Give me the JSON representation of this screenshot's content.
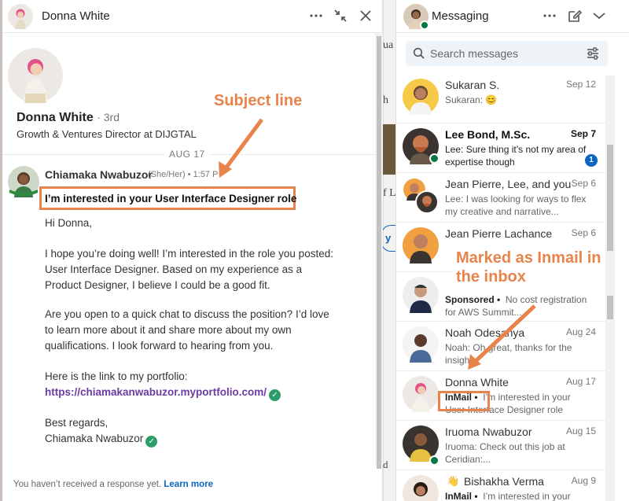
{
  "conversation": {
    "header_name": "Donna White",
    "profile": {
      "name": "Donna White",
      "degree": "· 3rd",
      "title": "Growth & Ventures Director at DIJGTAL"
    },
    "date_divider": "AUG 17",
    "message": {
      "sender": "Chiamaka Nwabuzor",
      "pronouns": "(She/Her) • 1:57 P",
      "subject": "I’m interested in your User Interface Designer role",
      "greeting": "Hi Donna,",
      "para1": "I hope you’re doing well! I’m interested in the role you posted: User Interface Designer. Based on my experience as a Product Designer, I believe I could be a good fit.",
      "para2": "Are you open to a quick chat to discuss the position? I’d love to learn more about it and share more about my own qualifications. I look forward to hearing from you.",
      "para3": "Here is the link to my portfolio:",
      "link": "https://chiamakanwabuzor.myportfolio.com/",
      "closing": "Best regards,",
      "signature": "Chiamaka Nwabuzor"
    },
    "footer": {
      "text": "You haven’t received a response yet.",
      "link": "Learn more"
    }
  },
  "messaging": {
    "title": "Messaging",
    "search_placeholder": "Search messages",
    "items": [
      {
        "name": "Sukaran S.",
        "date": "Sep 12",
        "snippet": "Sukaran: 😊"
      },
      {
        "name": "Lee Bond, M.Sc.",
        "date": "Sep 7",
        "snippet": "Lee: Sure thing it’s not my area of expertise though",
        "badge": "1"
      },
      {
        "name": "Jean Pierre, Lee, and you",
        "date": "Sep 6",
        "snippet": "Lee: I was looking for ways to flex my creative and narrative..."
      },
      {
        "name": "Jean Pierre Lachance",
        "date": "Sep 6",
        "snippet": ""
      },
      {
        "name": "",
        "date": "",
        "sponsored": "Sponsored •",
        "snippet": "No cost registration for AWS Summit..."
      },
      {
        "name": "Noah Odesanya",
        "date": "Aug 24",
        "snippet": "Noah: Oh great, thanks for the insight"
      },
      {
        "name": "Donna White",
        "date": "Aug 17",
        "inmail": "InMail •",
        "snippet": "I’m interested in your User Interface Designer role"
      },
      {
        "name": "Iruoma Nwabuzor",
        "date": "Aug 15",
        "snippet": "Iruoma: Check out this job at Ceridian:..."
      },
      {
        "name": "Bishakha Verma",
        "date": "Aug 9",
        "inmail": "InMail •",
        "snippet": "I’m interested in your"
      }
    ]
  },
  "annotations": {
    "subject_line": "Subject line",
    "inmail_line1": "Marked as Inmail in",
    "inmail_line2": "the inbox"
  },
  "background": {
    "frag1": "ua",
    "frag2": "h",
    "frag3": "f L",
    "frag4": "y",
    "frag5": "d"
  },
  "colors": {
    "annotation": "#e8834a",
    "link": "#6c3ba3",
    "brand_blue": "#0a66c2",
    "online_green": "#057642",
    "verified_green": "#2a9d6a"
  },
  "icons": [
    "ellipsis-icon",
    "collapse-icon",
    "close-icon",
    "compose-icon",
    "chevron-down-icon",
    "search-icon",
    "filter-icon",
    "verified-icon"
  ]
}
